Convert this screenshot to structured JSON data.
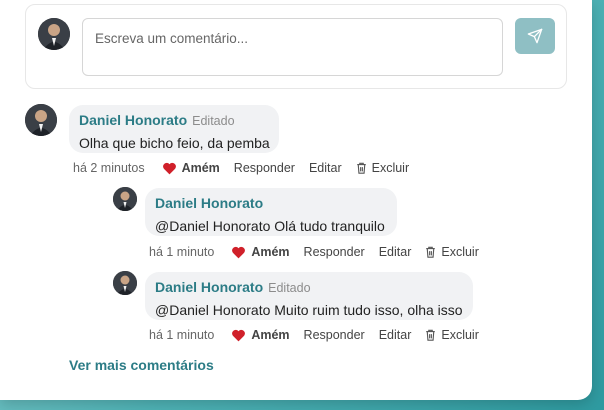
{
  "composer": {
    "placeholder": "Escreva um comentário...",
    "send_icon": "send-icon"
  },
  "comments": [
    {
      "author": "Daniel Honorato",
      "edited_label": "Editado",
      "text": "Olha que bicho feio, da pemba",
      "time": "há 2 minutos",
      "actions": {
        "amen": "Amém",
        "reply": "Responder",
        "edit": "Editar",
        "delete": "Excluir"
      },
      "replies": [
        {
          "author": "Daniel Honorato",
          "edited_label": "",
          "text": "@Daniel Honorato Olá tudo tranquilo",
          "time": "há 1 minuto",
          "actions": {
            "amen": "Amém",
            "reply": "Responder",
            "edit": "Editar",
            "delete": "Excluir"
          }
        },
        {
          "author": "Daniel Honorato",
          "edited_label": "Editado",
          "text": "@Daniel Honorato Muito ruim tudo isso, olha isso",
          "time": "há 1 minuto",
          "actions": {
            "amen": "Amém",
            "reply": "Responder",
            "edit": "Editar",
            "delete": "Excluir"
          }
        }
      ]
    }
  ],
  "more_comments": "Ver mais comentários",
  "colors": {
    "accent": "#2c7c86",
    "heart": "#d0202a",
    "send_button": "#8fbfc4"
  }
}
